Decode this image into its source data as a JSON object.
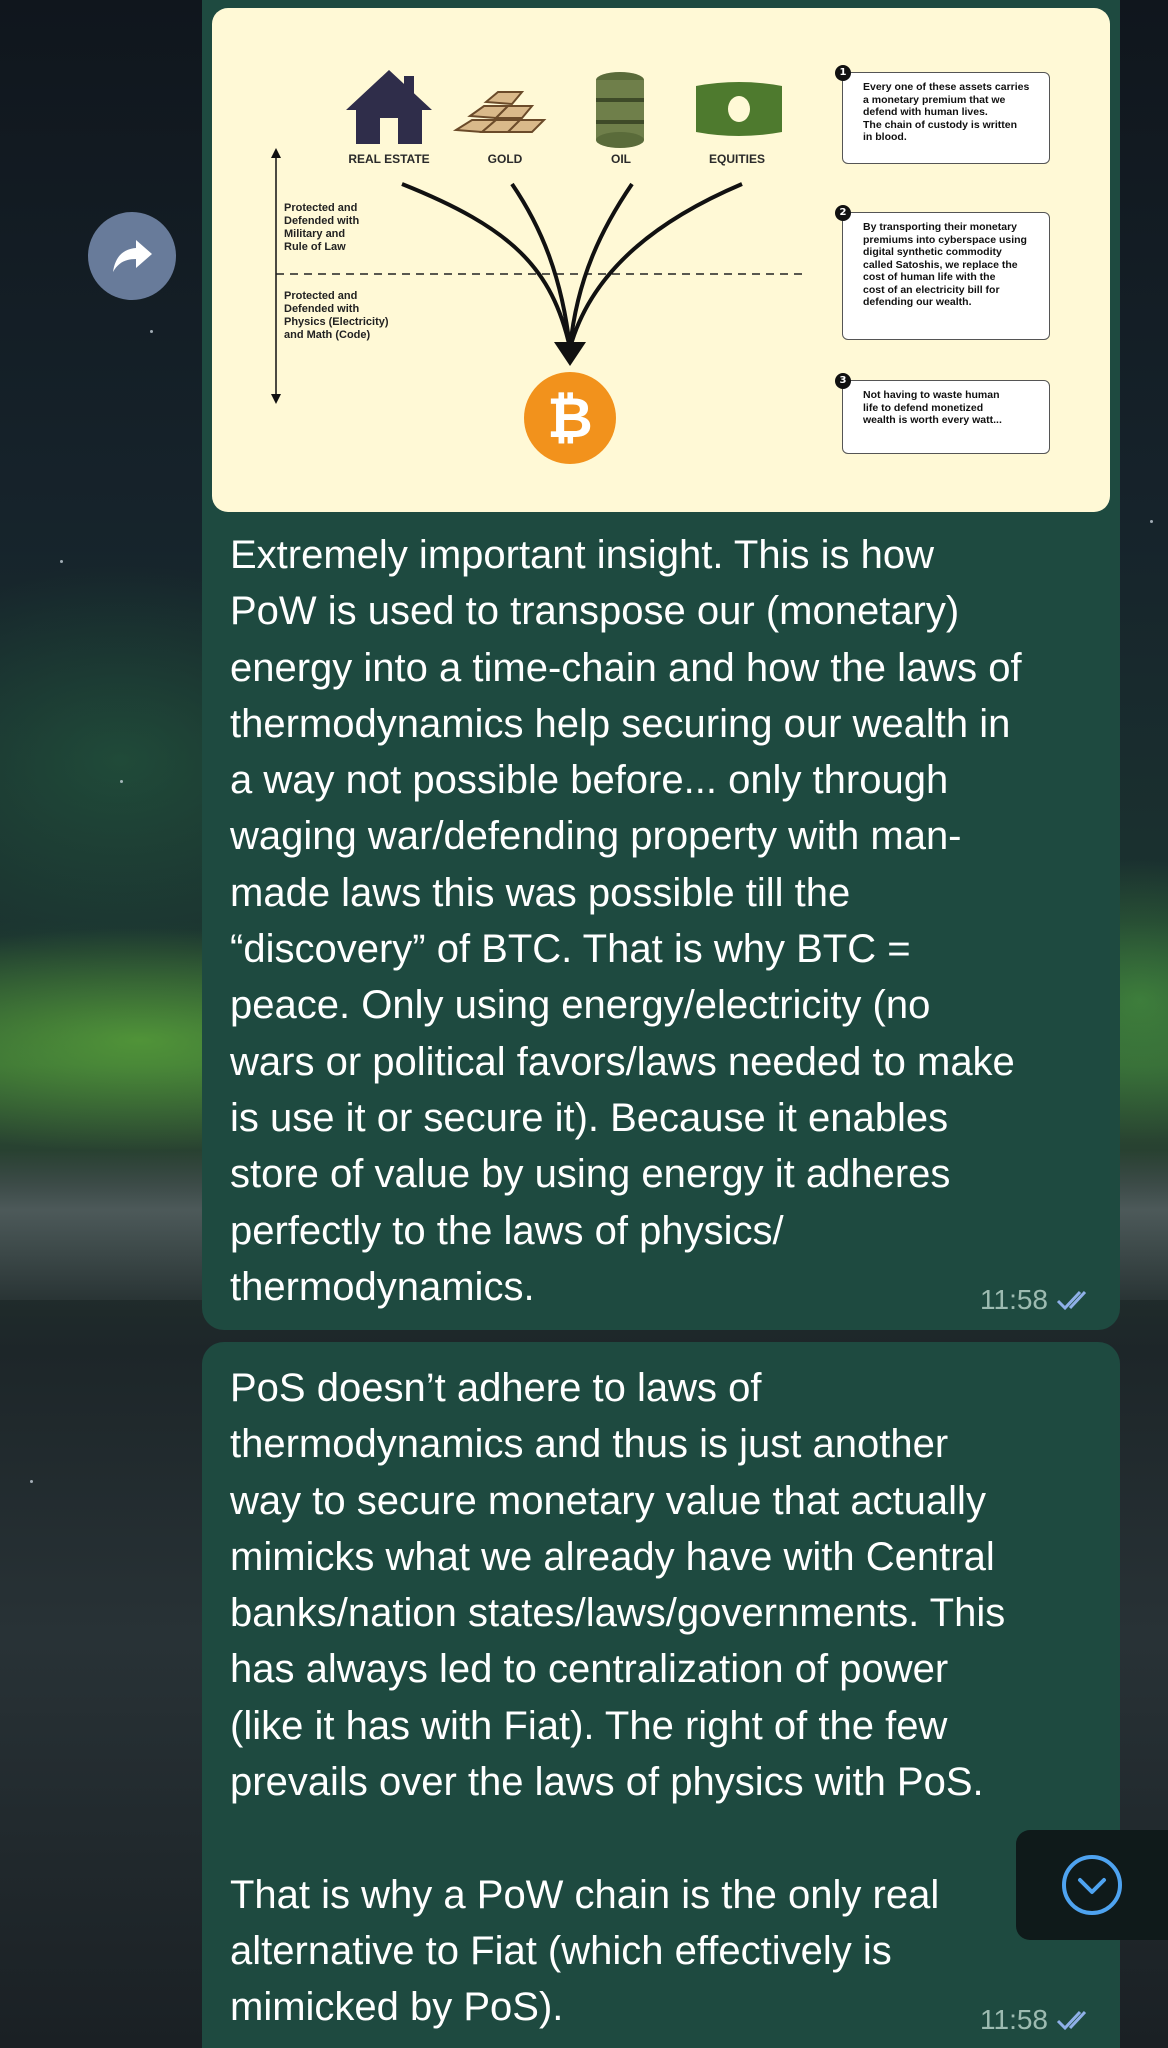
{
  "background": {
    "accent": "#1e4a40",
    "bubble_color": "#1e4a40",
    "media_bg": "#fff9d6"
  },
  "forward": {
    "icon": "share-arrow-icon"
  },
  "infographic": {
    "assets": [
      "REAL ESTATE",
      "GOLD",
      "OIL",
      "EQUITIES"
    ],
    "side_top": "Protected and\nDefended with\nMilitary and\nRule of Law",
    "side_bottom": "Protected and\nDefended with\nPhysics (Electricity)\nand Math (Code)",
    "bitcoin_symbol": "₿",
    "notes": [
      {
        "num": "1",
        "text": "Every one of these assets carries\na monetary premium that we\ndefend with human lives.\nThe chain of custody is written\nin blood."
      },
      {
        "num": "2",
        "text": "By transporting their monetary\npremiums into cyberspace using\ndigital synthetic commodity\ncalled Satoshis, we replace the\ncost of human life with the\ncost of an electricity bill for\ndefending our wealth."
      },
      {
        "num": "3",
        "text": "Not having to waste human\nlife to defend monetized\nwealth is worth every watt..."
      }
    ]
  },
  "messages": [
    {
      "text": "Extremely important insight. This is how\nPoW is used to transpose our (monetary)\nenergy into a time-chain and how the laws of\nthermodynamics help securing our wealth in\na way not possible before... only through\nwaging war/defending property with man-\nmade laws this was possible till the\n“discovery” of BTC. That is why BTC =\npeace. Only using energy/electricity (no\nwars or political favors/laws needed to make\nis use it or secure it). Because it enables\nstore of value by using energy it adheres\nperfectly to the laws of physics/\nthermodynamics.",
      "time": "11:58",
      "status_icon": "double-check-icon"
    },
    {
      "text": "PoS doesn’t adhere to laws of\nthermodynamics and thus is just another\nway to secure monetary value that actually\nmimicks what we already have with Central\nbanks/nation states/laws/governments. This\nhas always led to centralization of power\n(like it has with Fiat). The right of the few\nprevails over the laws of physics with PoS.\n\nThat is why a PoW chain is the only real\nalternative to Fiat (which effectively is\nmimicked by PoS).",
      "time": "11:58",
      "status_icon": "double-check-icon"
    }
  ],
  "scroll_button": {
    "icon": "chevron-down-icon"
  }
}
